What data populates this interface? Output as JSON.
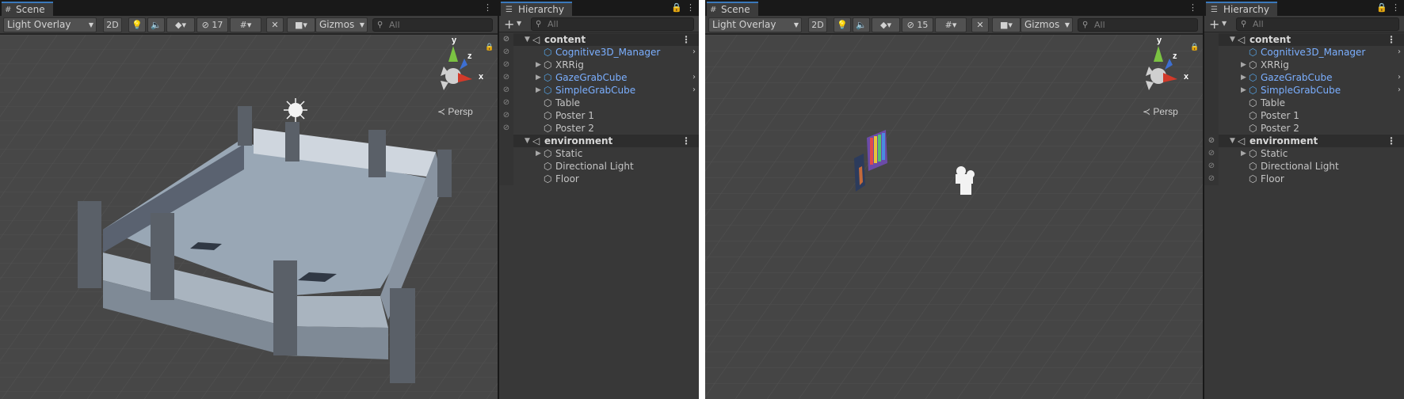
{
  "screens": [
    {
      "scene_tab": "Scene",
      "hierarchy_tab": "Hierarchy",
      "draw_mode": "Light Overlay",
      "btn_2d": "2D",
      "hidden_count": "17",
      "gizmos": "Gizmos",
      "scene_search_placeholder": "All",
      "hier_search_placeholder": "All",
      "persp_label": "Persp",
      "axis_labels": {
        "y": "y",
        "z": "z",
        "x": "x"
      },
      "hierarchy": [
        {
          "kind": "scene",
          "label": "content",
          "vis": true
        },
        {
          "kind": "object",
          "label": "Cognitive3D_Manager",
          "prefab": true,
          "fold": false,
          "arrow": true,
          "vis": true
        },
        {
          "kind": "object",
          "label": "XRRig",
          "prefab": false,
          "fold": true,
          "arrow": false,
          "vis": true
        },
        {
          "kind": "object",
          "label": "GazeGrabCube",
          "prefab": true,
          "fold": true,
          "arrow": true,
          "vis": true
        },
        {
          "kind": "object",
          "label": "SimpleGrabCube",
          "prefab": true,
          "fold": true,
          "arrow": true,
          "vis": true
        },
        {
          "kind": "object",
          "label": "Table",
          "prefab": false,
          "fold": false,
          "arrow": false,
          "vis": true
        },
        {
          "kind": "object",
          "label": "Poster 1",
          "prefab": false,
          "fold": false,
          "arrow": false,
          "vis": true
        },
        {
          "kind": "object",
          "label": "Poster 2",
          "prefab": false,
          "fold": false,
          "arrow": false,
          "vis": true
        },
        {
          "kind": "scene",
          "label": "environment",
          "vis": false
        },
        {
          "kind": "object",
          "label": "Static",
          "prefab": false,
          "fold": true,
          "arrow": false,
          "vis": false
        },
        {
          "kind": "object",
          "label": "Directional Light",
          "prefab": false,
          "fold": false,
          "arrow": false,
          "vis": false
        },
        {
          "kind": "object",
          "label": "Floor",
          "prefab": false,
          "fold": false,
          "arrow": false,
          "vis": false
        }
      ]
    },
    {
      "scene_tab": "Scene",
      "hierarchy_tab": "Hierarchy",
      "draw_mode": "Light Overlay",
      "btn_2d": "2D",
      "hidden_count": "15",
      "gizmos": "Gizmos",
      "scene_search_placeholder": "All",
      "hier_search_placeholder": "All",
      "persp_label": "Persp",
      "axis_labels": {
        "y": "y",
        "z": "z",
        "x": "x"
      },
      "hierarchy": [
        {
          "kind": "scene",
          "label": "content",
          "vis": false
        },
        {
          "kind": "object",
          "label": "Cognitive3D_Manager",
          "prefab": true,
          "fold": false,
          "arrow": true,
          "vis": false
        },
        {
          "kind": "object",
          "label": "XRRig",
          "prefab": false,
          "fold": true,
          "arrow": false,
          "vis": false
        },
        {
          "kind": "object",
          "label": "GazeGrabCube",
          "prefab": true,
          "fold": true,
          "arrow": true,
          "vis": false
        },
        {
          "kind": "object",
          "label": "SimpleGrabCube",
          "prefab": true,
          "fold": true,
          "arrow": true,
          "vis": false
        },
        {
          "kind": "object",
          "label": "Table",
          "prefab": false,
          "fold": false,
          "arrow": false,
          "vis": false
        },
        {
          "kind": "object",
          "label": "Poster 1",
          "prefab": false,
          "fold": false,
          "arrow": false,
          "vis": false
        },
        {
          "kind": "object",
          "label": "Poster 2",
          "prefab": false,
          "fold": false,
          "arrow": false,
          "vis": false
        },
        {
          "kind": "scene",
          "label": "environment",
          "vis": true
        },
        {
          "kind": "object",
          "label": "Static",
          "prefab": false,
          "fold": true,
          "arrow": false,
          "vis": true
        },
        {
          "kind": "object",
          "label": "Directional Light",
          "prefab": false,
          "fold": false,
          "arrow": false,
          "vis": true
        },
        {
          "kind": "object",
          "label": "Floor",
          "prefab": false,
          "fold": false,
          "arrow": false,
          "vis": true
        }
      ]
    }
  ]
}
